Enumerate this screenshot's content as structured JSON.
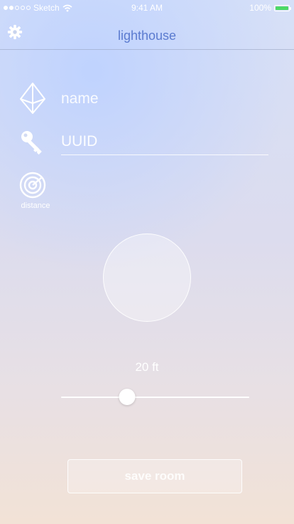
{
  "status_bar": {
    "carrier": "Sketch",
    "time": "9:41 AM",
    "battery": "100%",
    "battery_level": 1.0,
    "signal_dots_filled": 2,
    "signal_dots_total": 5
  },
  "nav": {
    "title": "lighthouse",
    "settings_icon": "gear-icon"
  },
  "form": {
    "name_placeholder": "name",
    "uuid_placeholder": "UUID",
    "distance_label": "distance"
  },
  "distance": {
    "value_text": "20 ft",
    "slider_fraction": 0.35
  },
  "save_button": {
    "label": "save room"
  },
  "colors": {
    "title": "#5b7bd0",
    "battery": "#4cd964"
  }
}
